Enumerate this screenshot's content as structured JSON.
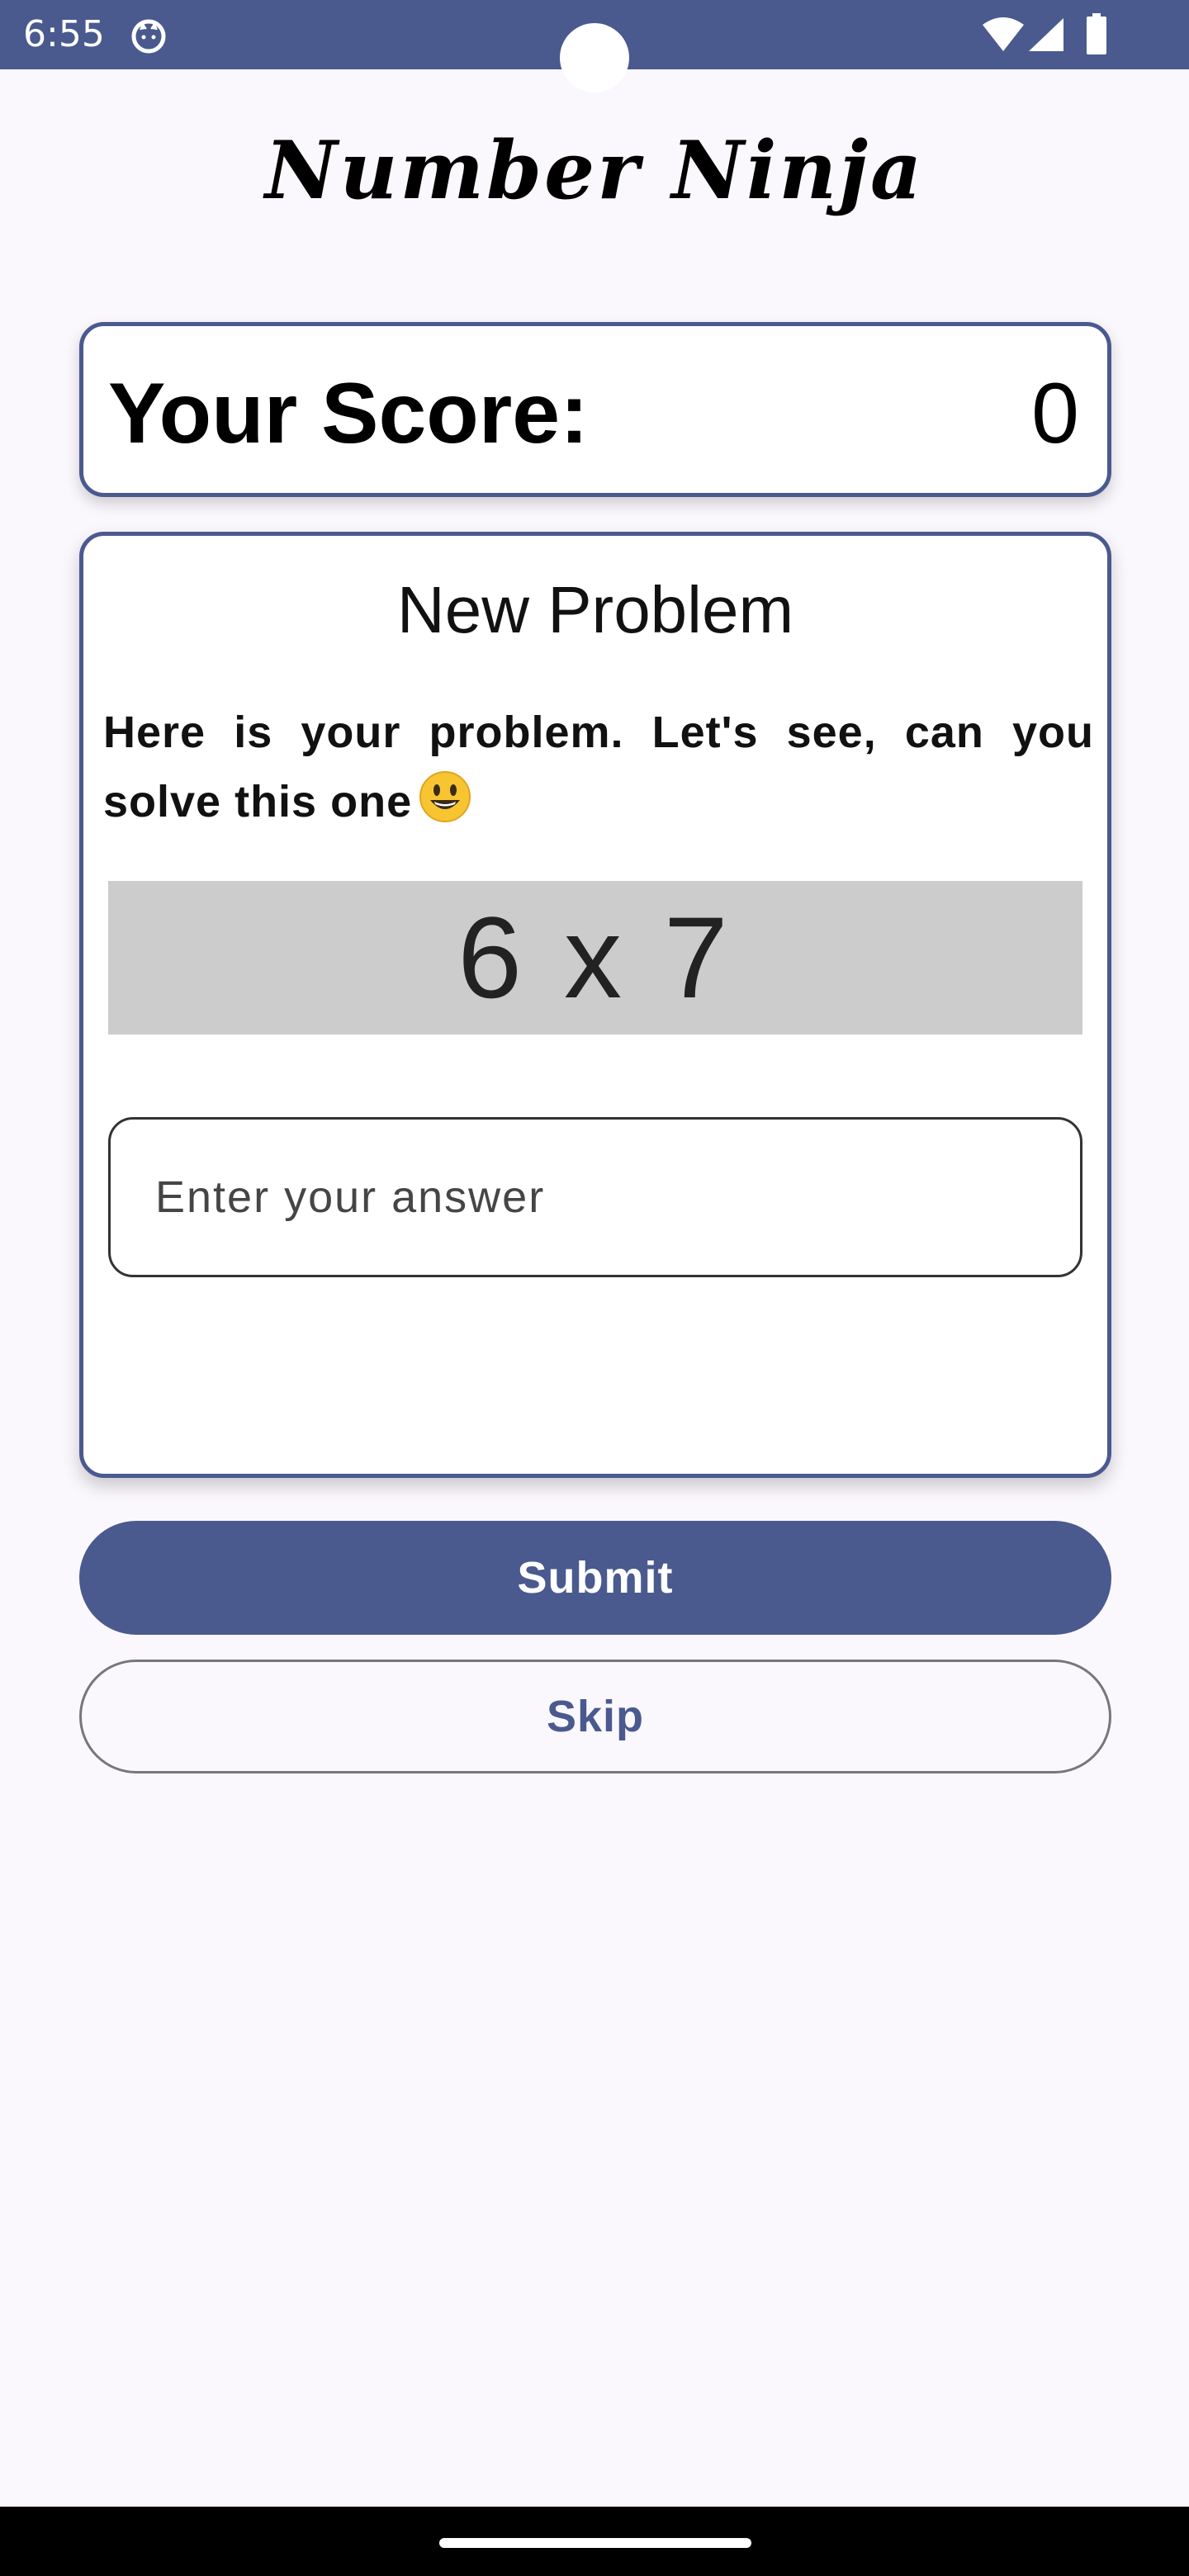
{
  "status_bar": {
    "time": "6:55",
    "icons": [
      "cat-icon",
      "wifi-icon",
      "signal-icon",
      "battery-icon"
    ],
    "background_color": "#4a5a8f"
  },
  "app": {
    "title": "Number Ninja"
  },
  "score": {
    "label": "Your Score:",
    "value": "0"
  },
  "problem": {
    "heading": "New Problem",
    "intro": "Here is your problem. Let's see, can you solve this one",
    "emoji": "smiling-face-icon",
    "question": "6 x 7"
  },
  "answer": {
    "value": "",
    "placeholder": "Enter your answer"
  },
  "actions": {
    "submit_label": "Submit",
    "skip_label": "Skip"
  },
  "colors": {
    "accent": "#4a5a8f",
    "background": "#fbf8fd",
    "question_box": "#cccccc"
  }
}
